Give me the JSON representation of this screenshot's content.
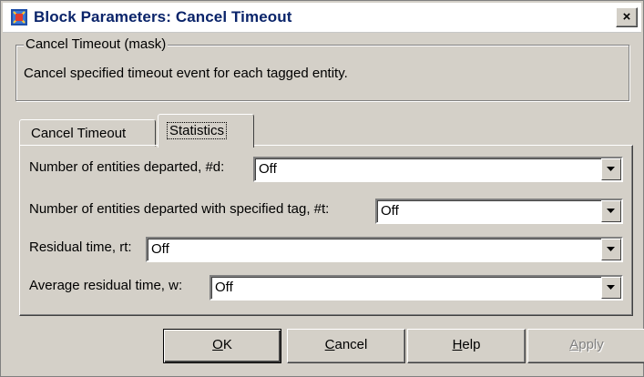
{
  "window": {
    "title": "Block Parameters: Cancel Timeout",
    "close_label": "×"
  },
  "mask": {
    "group_label": "Cancel Timeout (mask)",
    "description": "Cancel specified timeout event for each tagged entity."
  },
  "tabs": [
    {
      "label": "Cancel Timeout",
      "active": false
    },
    {
      "label": "Statistics",
      "active": true
    }
  ],
  "params": [
    {
      "label": "Number of entities departed, #d:",
      "value": "Off"
    },
    {
      "label": "Number of entities departed with specified tag, #t:",
      "value": "Off"
    },
    {
      "label": "Residual time, rt:",
      "value": "Off"
    },
    {
      "label": "Average residual time, w:",
      "value": "Off"
    }
  ],
  "buttons": {
    "ok": {
      "mnemonic": "O",
      "rest": "K"
    },
    "cancel": {
      "mnemonic": "C",
      "rest": "ancel"
    },
    "help": {
      "mnemonic": "H",
      "rest": "elp"
    },
    "apply": {
      "mnemonic": "A",
      "rest": "pply",
      "enabled": false
    }
  },
  "icons": {
    "app": "simulink-block-icon",
    "close": "close-icon",
    "dropdown": "chevron-down-icon"
  }
}
